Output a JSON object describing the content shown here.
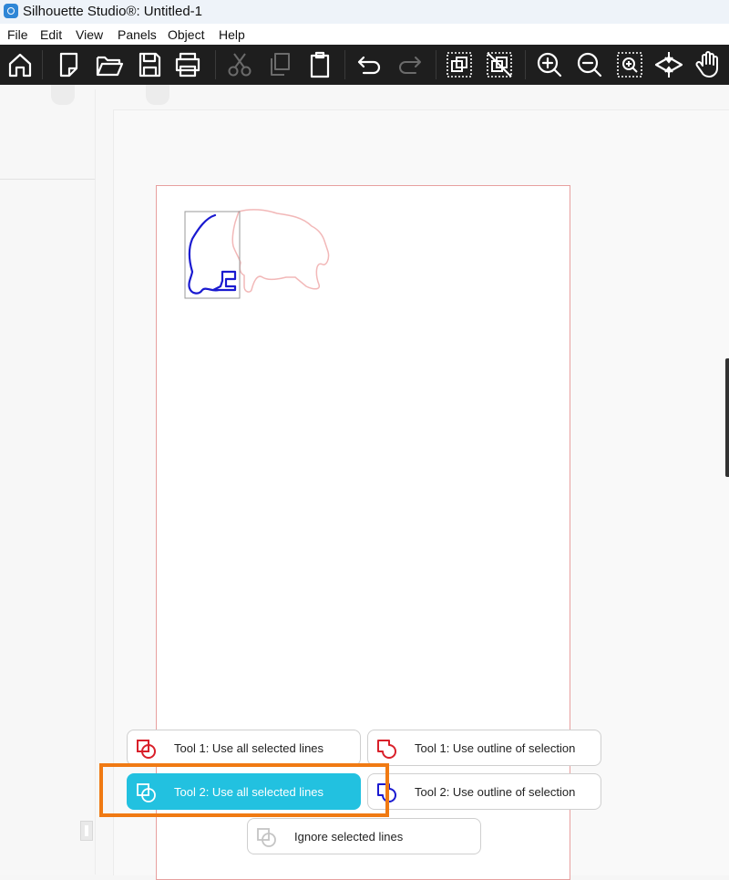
{
  "window": {
    "title": "Silhouette Studio®: Untitled-1",
    "app_icon": "silhouette-app-icon"
  },
  "menubar": {
    "items": [
      "File",
      "Edit",
      "View",
      "Panels",
      "Object",
      "Help"
    ]
  },
  "toolbar": {
    "buttons": [
      {
        "icon": "home-icon",
        "enabled": true
      },
      {
        "icon": "new-document-icon",
        "enabled": true
      },
      {
        "icon": "open-folder-icon",
        "enabled": true
      },
      {
        "icon": "save-icon",
        "enabled": true
      },
      {
        "icon": "print-icon",
        "enabled": true
      },
      {
        "icon": "cut-icon",
        "enabled": false
      },
      {
        "icon": "copy-icon",
        "enabled": false
      },
      {
        "icon": "paste-icon",
        "enabled": true
      },
      {
        "icon": "undo-icon",
        "enabled": true
      },
      {
        "icon": "redo-icon",
        "enabled": false
      },
      {
        "icon": "group-icon",
        "enabled": true
      },
      {
        "icon": "ungroup-icon",
        "enabled": true
      },
      {
        "icon": "zoom-in-icon",
        "enabled": true
      },
      {
        "icon": "zoom-out-icon",
        "enabled": true
      },
      {
        "icon": "zoom-to-fit-icon",
        "enabled": true
      },
      {
        "icon": "fit-to-page-icon",
        "enabled": true
      },
      {
        "icon": "pan-hand-icon",
        "enabled": true
      }
    ]
  },
  "colors": {
    "toolbar_bg": "#1e1e1e",
    "page_border": "#e7a09f",
    "drawn_line": "#1a1ad0",
    "bear_outline": "#f2b8b8",
    "active_button": "#22c1e0",
    "highlight_box": "#f07a13",
    "tool1_color": "#d9202a",
    "tool2_color": "#1a1ad0"
  },
  "trace_options": {
    "tool1_all_lines": "Tool 1: Use all selected lines",
    "tool1_outline": "Tool 1: Use outline of selection",
    "tool2_all_lines": "Tool 2: Use all selected lines",
    "tool2_outline": "Tool 2: Use outline of selection",
    "ignore_lines": "Ignore selected lines",
    "selected": "tool2_all_lines"
  }
}
